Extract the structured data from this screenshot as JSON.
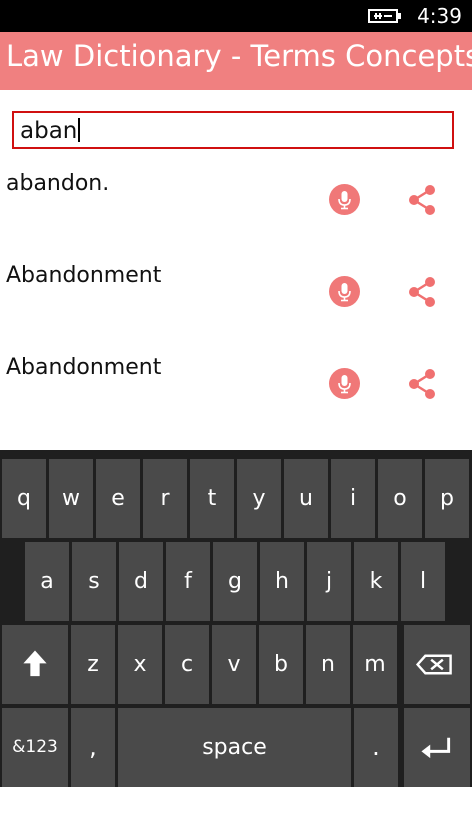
{
  "status_bar": {
    "time": "4:39",
    "battery_icon": "battery-charging-icon"
  },
  "header": {
    "title": "Law Dictionary - Terms Concepts"
  },
  "search": {
    "value": "aban"
  },
  "results": [
    {
      "term": "abandon."
    },
    {
      "term": "Abandonment"
    },
    {
      "term": "Abandonment"
    }
  ],
  "icons": {
    "mic": "microphone-icon",
    "share": "share-icon"
  },
  "colors": {
    "accent": "#f08080",
    "search_border": "#d01010",
    "keyboard_bg": "#1f1f1f",
    "key_bg": "#4a4a4a"
  },
  "keyboard": {
    "row1": [
      "q",
      "w",
      "e",
      "r",
      "t",
      "y",
      "u",
      "i",
      "o",
      "p"
    ],
    "row2": [
      "a",
      "s",
      "d",
      "f",
      "g",
      "h",
      "j",
      "k",
      "l"
    ],
    "row3": [
      "z",
      "x",
      "c",
      "v",
      "b",
      "n",
      "m"
    ],
    "shift_icon": "shift-arrow-icon",
    "backspace_icon": "backspace-icon",
    "enter_icon": "enter-icon",
    "numbers_label": "&123",
    "comma_label": ",",
    "space_label": "space",
    "period_label": "."
  }
}
